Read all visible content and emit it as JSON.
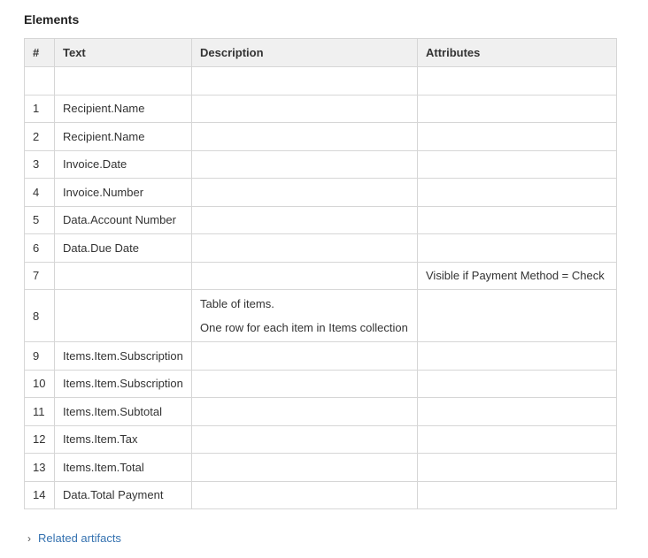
{
  "section_title": "Elements",
  "table": {
    "headers": [
      "#",
      "Text",
      "Description",
      "Attributes"
    ],
    "rows": [
      {
        "num": "",
        "text": "",
        "description": [],
        "attributes": ""
      },
      {
        "num": "1",
        "text": "Recipient.Name",
        "description": [],
        "attributes": ""
      },
      {
        "num": "2",
        "text": "Recipient.Name",
        "description": [],
        "attributes": ""
      },
      {
        "num": "3",
        "text": "Invoice.Date",
        "description": [],
        "attributes": ""
      },
      {
        "num": "4",
        "text": "Invoice.Number",
        "description": [],
        "attributes": ""
      },
      {
        "num": "5",
        "text": "Data.Account Number",
        "description": [],
        "attributes": ""
      },
      {
        "num": "6",
        "text": "Data.Due Date",
        "description": [],
        "attributes": ""
      },
      {
        "num": "7",
        "text": "",
        "description": [],
        "attributes": "Visible if Payment Method = Check"
      },
      {
        "num": "8",
        "text": "",
        "description": [
          "Table of items.",
          "One row for each item in Items collection"
        ],
        "attributes": ""
      },
      {
        "num": "9",
        "text": "Items.Item.Subscription",
        "description": [],
        "attributes": ""
      },
      {
        "num": "10",
        "text": "Items.Item.Subscription",
        "description": [],
        "attributes": ""
      },
      {
        "num": "11",
        "text": "Items.Item.Subtotal",
        "description": [],
        "attributes": ""
      },
      {
        "num": "12",
        "text": "Items.Item.Tax",
        "description": [],
        "attributes": ""
      },
      {
        "num": "13",
        "text": "Items.Item.Total",
        "description": [],
        "attributes": ""
      },
      {
        "num": "14",
        "text": "Data.Total Payment",
        "description": [],
        "attributes": ""
      }
    ]
  },
  "related": {
    "label": "Related artifacts",
    "icon": "chevron-right-icon",
    "link_color": "#3572b0"
  }
}
